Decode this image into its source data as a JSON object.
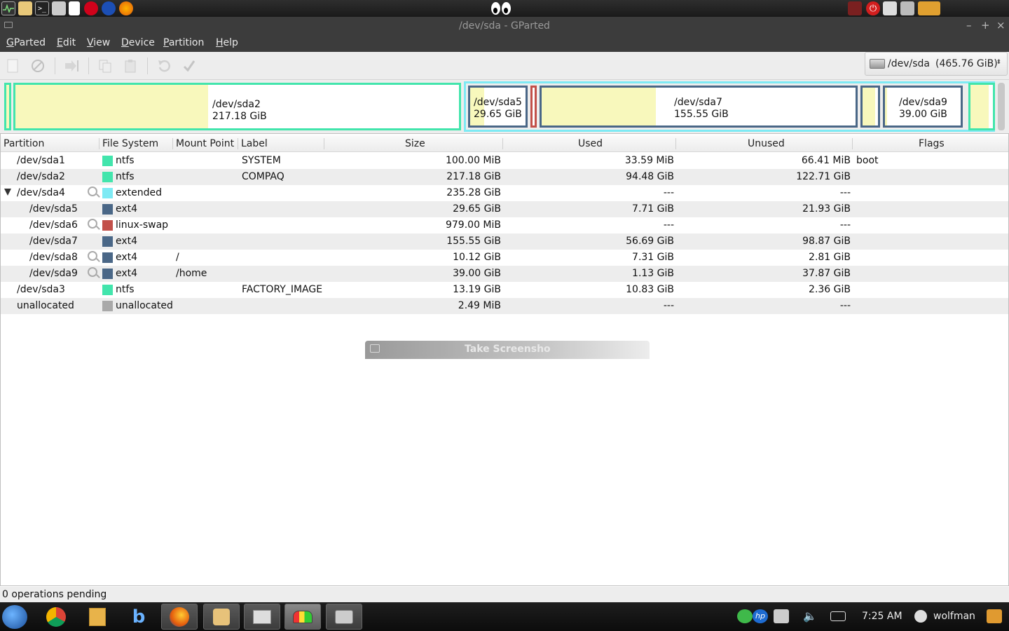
{
  "window": {
    "title": "/dev/sda - GParted"
  },
  "menu": [
    "GParted",
    "Edit",
    "View",
    "Device",
    "Partition",
    "Help"
  ],
  "menu_mnemonic_index": [
    0,
    0,
    0,
    0,
    0,
    0
  ],
  "device_selector": {
    "device": "/dev/sda",
    "size": "(465.76 GiB)"
  },
  "partition_map": [
    {
      "name": "/dev/sda2",
      "size": "217.18 GiB"
    },
    {
      "name": "/dev/sda5",
      "size": "29.65 GiB"
    },
    {
      "name": "/dev/sda7",
      "size": "155.55 GiB"
    },
    {
      "name": "/dev/sda9",
      "size": "39.00 GiB"
    }
  ],
  "table": {
    "headers": [
      "Partition",
      "File System",
      "Mount Point",
      "Label",
      "Size",
      "Used",
      "Unused",
      "Flags"
    ],
    "rows": [
      {
        "partition": "/dev/sda1",
        "fs": "ntfs",
        "fs_color": "#42e5ac",
        "mount": "",
        "label": "SYSTEM",
        "size": "100.00 MiB",
        "used": "33.59 MiB",
        "unused": "66.41 MiB",
        "flags": "boot",
        "indent": 0,
        "locked": false,
        "expander": false
      },
      {
        "partition": "/dev/sda2",
        "fs": "ntfs",
        "fs_color": "#42e5ac",
        "mount": "",
        "label": "COMPAQ",
        "size": "217.18 GiB",
        "used": "94.48 GiB",
        "unused": "122.71 GiB",
        "flags": "",
        "indent": 0,
        "locked": false,
        "expander": false
      },
      {
        "partition": "/dev/sda4",
        "fs": "extended",
        "fs_color": "#7eeaf4",
        "mount": "",
        "label": "",
        "size": "235.28 GiB",
        "used": "---",
        "unused": "---",
        "flags": "",
        "indent": 0,
        "locked": true,
        "expander": true
      },
      {
        "partition": "/dev/sda5",
        "fs": "ext4",
        "fs_color": "#4a6787",
        "mount": "",
        "label": "",
        "size": "29.65 GiB",
        "used": "7.71 GiB",
        "unused": "21.93 GiB",
        "flags": "",
        "indent": 1,
        "locked": false,
        "expander": false
      },
      {
        "partition": "/dev/sda6",
        "fs": "linux-swap",
        "fs_color": "#c2504a",
        "mount": "",
        "label": "",
        "size": "979.00 MiB",
        "used": "---",
        "unused": "---",
        "flags": "",
        "indent": 1,
        "locked": true,
        "expander": false
      },
      {
        "partition": "/dev/sda7",
        "fs": "ext4",
        "fs_color": "#4a6787",
        "mount": "",
        "label": "",
        "size": "155.55 GiB",
        "used": "56.69 GiB",
        "unused": "98.87 GiB",
        "flags": "",
        "indent": 1,
        "locked": false,
        "expander": false
      },
      {
        "partition": "/dev/sda8",
        "fs": "ext4",
        "fs_color": "#4a6787",
        "mount": "/",
        "label": "",
        "size": "10.12 GiB",
        "used": "7.31 GiB",
        "unused": "2.81 GiB",
        "flags": "",
        "indent": 1,
        "locked": true,
        "expander": false
      },
      {
        "partition": "/dev/sda9",
        "fs": "ext4",
        "fs_color": "#4a6787",
        "mount": "/home",
        "label": "",
        "size": "39.00 GiB",
        "used": "1.13 GiB",
        "unused": "37.87 GiB",
        "flags": "",
        "indent": 1,
        "locked": true,
        "expander": false
      },
      {
        "partition": "/dev/sda3",
        "fs": "ntfs",
        "fs_color": "#42e5ac",
        "mount": "",
        "label": "FACTORY_IMAGE",
        "size": "13.19 GiB",
        "used": "10.83 GiB",
        "unused": "2.36 GiB",
        "flags": "",
        "indent": 0,
        "locked": false,
        "expander": false
      },
      {
        "partition": "unallocated",
        "fs": "unallocated",
        "fs_color": "#a9a9a9",
        "mount": "",
        "label": "",
        "size": "2.49 MiB",
        "used": "---",
        "unused": "---",
        "flags": "",
        "indent": 0,
        "locked": false,
        "expander": false
      }
    ]
  },
  "ghost_dialog": {
    "title": "Take Screensho"
  },
  "status": "0 operations pending",
  "taskbar": {
    "clock": "7:25 AM",
    "user": "wolfman"
  }
}
